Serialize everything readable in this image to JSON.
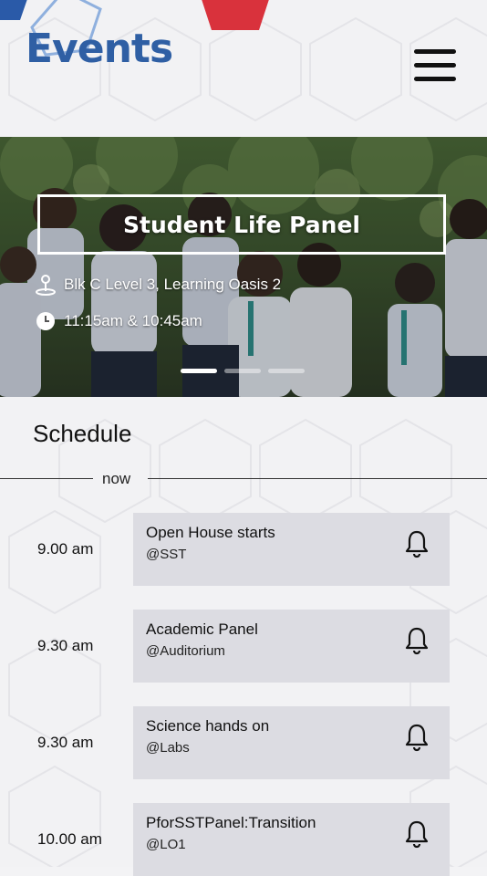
{
  "header": {
    "title": "Events",
    "menu_icon": "hamburger-menu-icon"
  },
  "banner": {
    "title": "Student Life Panel",
    "location": "Blk C Level 3, Learning Oasis 2",
    "time": "11:15am & 10:45am",
    "location_icon": "location-pin-icon",
    "time_icon": "clock-icon",
    "pages": 3,
    "active_page": 1
  },
  "schedule": {
    "title": "Schedule",
    "now_label": "now",
    "items": [
      {
        "time": "9.00 am",
        "name": "Open House starts",
        "place": "@SST"
      },
      {
        "time": "9.30 am",
        "name": "Academic Panel",
        "place": "@Auditorium"
      },
      {
        "time": "9.30 am",
        "name": "Science hands on",
        "place": "@Labs"
      },
      {
        "time": "10.00 am",
        "name": "PforSSTPanel:Transition",
        "place": "@LO1"
      }
    ]
  },
  "colors": {
    "title_blue": "#2f5fa4",
    "card_bg": "#dcdce2",
    "accent_red": "#d9323c",
    "deco_blue": "#2a5aa8"
  }
}
